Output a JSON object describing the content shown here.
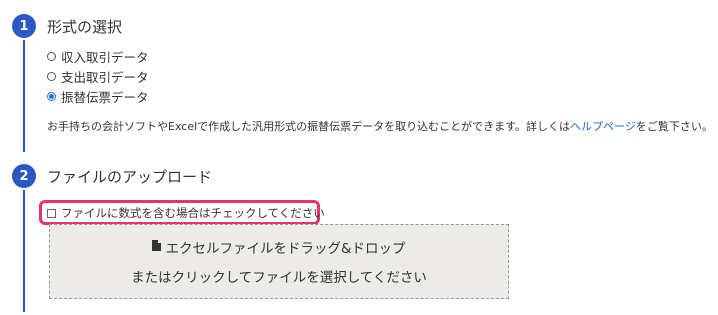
{
  "step1": {
    "number": "1",
    "title": "形式の選択",
    "options": [
      {
        "label": "収入取引データ",
        "selected": false
      },
      {
        "label": "支出取引データ",
        "selected": false
      },
      {
        "label": "振替伝票データ",
        "selected": true
      }
    ],
    "description_before": "お手持ちの会計ソフトやExcelで作成した汎用形式の振替伝票データを取り込むことができます。詳しくは",
    "description_link": "ヘルプページ",
    "description_after": "をご覧下さい。"
  },
  "step2": {
    "number": "2",
    "title": "ファイルのアップロード",
    "checkbox_label": "ファイルに数式を含む場合はチェックしてください",
    "checkbox_checked": false,
    "dropzone_line1": "エクセルファイルをドラッグ&ドロップ",
    "dropzone_line2": "またはクリックしてファイルを選択してください"
  },
  "colors": {
    "accent": "#2b59c3",
    "highlight": "#e8336a",
    "link": "#1a6ccc",
    "radio_selected": "#1a73e8",
    "dropzone_bg": "#ecebe8"
  },
  "icons": {
    "dropzone": "file-icon"
  }
}
